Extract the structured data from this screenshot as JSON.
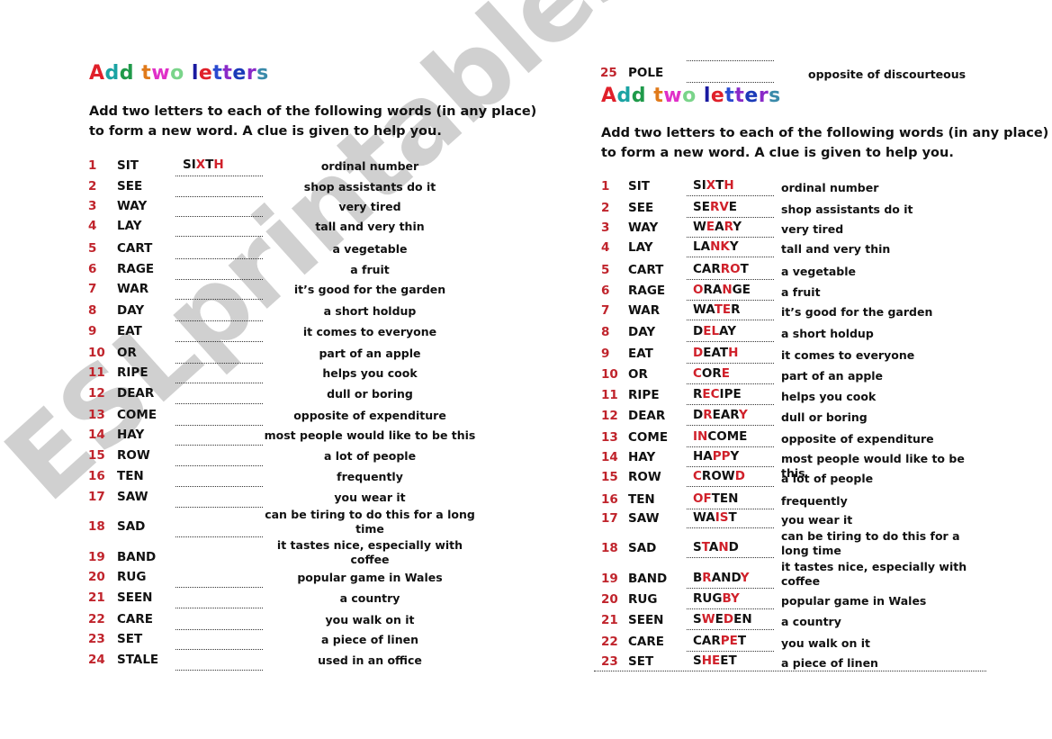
{
  "worksheet": {
    "title_letters": [
      {
        "ch": "A",
        "color": "#e0202a"
      },
      {
        "ch": "d",
        "color": "#1aa3a3"
      },
      {
        "ch": "d",
        "color": "#1f9a4a"
      },
      {
        "ch": " ",
        "color": "#000000"
      },
      {
        "ch": "t",
        "color": "#e07a1a"
      },
      {
        "ch": "w",
        "color": "#e030c8"
      },
      {
        "ch": "o",
        "color": "#7ad48a"
      },
      {
        "ch": " ",
        "color": "#000000"
      },
      {
        "ch": "l",
        "color": "#1a1aa0"
      },
      {
        "ch": "e",
        "color": "#e0202a"
      },
      {
        "ch": "t",
        "color": "#2a4ad0"
      },
      {
        "ch": "t",
        "color": "#8a2ac8"
      },
      {
        "ch": "e",
        "color": "#1a3ab8"
      },
      {
        "ch": "r",
        "color": "#8a2ac8"
      },
      {
        "ch": "s",
        "color": "#3a8aaa"
      }
    ],
    "instructions_line1": "Add two letters to each of the following words (in any place)",
    "instructions_line2": "to form a new word. A clue is given to help you.",
    "questions": [
      {
        "n": "1",
        "word": "SIT",
        "clue": "ordinal number"
      },
      {
        "n": "2",
        "word": "SEE",
        "clue": "shop assistants do it"
      },
      {
        "n": "3",
        "word": "WAY",
        "clue": "very tired"
      },
      {
        "n": "4",
        "word": "LAY",
        "clue": "tall and very thin"
      },
      {
        "n": "5",
        "word": "CART",
        "clue": "a vegetable"
      },
      {
        "n": "6",
        "word": "RAGE",
        "clue": "a fruit"
      },
      {
        "n": "7",
        "word": "WAR",
        "clue": "it’s good for the garden"
      },
      {
        "n": "8",
        "word": "DAY",
        "clue": "a short holdup"
      },
      {
        "n": "9",
        "word": "EAT",
        "clue": "it comes to everyone"
      },
      {
        "n": "10",
        "word": "OR",
        "clue": "part of an apple"
      },
      {
        "n": "11",
        "word": "RIPE",
        "clue": "helps you cook"
      },
      {
        "n": "12",
        "word": "DEAR",
        "clue": "dull or boring"
      },
      {
        "n": "13",
        "word": "COME",
        "clue": "opposite of expenditure"
      },
      {
        "n": "14",
        "word": "HAY",
        "clue": "most people would like to be this"
      },
      {
        "n": "15",
        "word": "ROW",
        "clue": "a lot of people"
      },
      {
        "n": "16",
        "word": "TEN",
        "clue": "frequently"
      },
      {
        "n": "17",
        "word": "SAW",
        "clue": "you wear it"
      },
      {
        "n": "18",
        "word": "SAD",
        "clue": "can be tiring to do this for a long time"
      },
      {
        "n": "19",
        "word": "BAND",
        "clue": "it tastes nice, especially with coffee"
      },
      {
        "n": "20",
        "word": "RUG",
        "clue": "popular game in Wales"
      },
      {
        "n": "21",
        "word": "SEEN",
        "clue": "a country"
      },
      {
        "n": "22",
        "word": "CARE",
        "clue": "you walk on it"
      },
      {
        "n": "23",
        "word": "SET",
        "clue": "a piece of linen"
      },
      {
        "n": "24",
        "word": "STALE",
        "clue": "used in an office"
      },
      {
        "n": "25",
        "word": "POLE",
        "clue": "opposite of discourteous"
      }
    ],
    "left_example_answer": [
      {
        "t": "SI",
        "add": false
      },
      {
        "t": "X",
        "add": true
      },
      {
        "t": "T",
        "add": false
      },
      {
        "t": "H",
        "add": true
      }
    ],
    "answers": [
      [
        {
          "t": "SI",
          "add": false
        },
        {
          "t": "X",
          "add": true
        },
        {
          "t": "T",
          "add": false
        },
        {
          "t": "H",
          "add": true
        }
      ],
      [
        {
          "t": "SE",
          "add": false
        },
        {
          "t": "RV",
          "add": true
        },
        {
          "t": "E",
          "add": false
        }
      ],
      [
        {
          "t": "W",
          "add": false
        },
        {
          "t": "E",
          "add": true
        },
        {
          "t": "A",
          "add": false
        },
        {
          "t": "R",
          "add": true
        },
        {
          "t": "Y",
          "add": false
        }
      ],
      [
        {
          "t": "LA",
          "add": false
        },
        {
          "t": "NK",
          "add": true
        },
        {
          "t": "Y",
          "add": false
        }
      ],
      [
        {
          "t": "CAR",
          "add": false
        },
        {
          "t": "RO",
          "add": true
        },
        {
          "t": "T",
          "add": false
        }
      ],
      [
        {
          "t": "O",
          "add": true
        },
        {
          "t": "RA",
          "add": false
        },
        {
          "t": "N",
          "add": true
        },
        {
          "t": "GE",
          "add": false
        }
      ],
      [
        {
          "t": "WA",
          "add": false
        },
        {
          "t": "TE",
          "add": true
        },
        {
          "t": "R",
          "add": false
        }
      ],
      [
        {
          "t": "D",
          "add": false
        },
        {
          "t": "EL",
          "add": true
        },
        {
          "t": "AY",
          "add": false
        }
      ],
      [
        {
          "t": "D",
          "add": true
        },
        {
          "t": "EAT",
          "add": false
        },
        {
          "t": "H",
          "add": true
        }
      ],
      [
        {
          "t": "C",
          "add": true
        },
        {
          "t": "OR",
          "add": false
        },
        {
          "t": "E",
          "add": true
        }
      ],
      [
        {
          "t": "R",
          "add": false
        },
        {
          "t": "EC",
          "add": true
        },
        {
          "t": "IPE",
          "add": false
        }
      ],
      [
        {
          "t": "D",
          "add": false
        },
        {
          "t": "R",
          "add": true
        },
        {
          "t": "EAR",
          "add": false
        },
        {
          "t": "Y",
          "add": true
        }
      ],
      [
        {
          "t": "IN",
          "add": true
        },
        {
          "t": "COME",
          "add": false
        }
      ],
      [
        {
          "t": "HA",
          "add": false
        },
        {
          "t": "PP",
          "add": true
        },
        {
          "t": "Y",
          "add": false
        }
      ],
      [
        {
          "t": "C",
          "add": true
        },
        {
          "t": "ROW",
          "add": false
        },
        {
          "t": "D",
          "add": true
        }
      ],
      [
        {
          "t": "OF",
          "add": true
        },
        {
          "t": "TEN",
          "add": false
        }
      ],
      [
        {
          "t": "WA",
          "add": false
        },
        {
          "t": "IS",
          "add": true
        },
        {
          "t": "T",
          "add": false
        }
      ],
      [
        {
          "t": "S",
          "add": false
        },
        {
          "t": "T",
          "add": true
        },
        {
          "t": "A",
          "add": false
        },
        {
          "t": "N",
          "add": true
        },
        {
          "t": "D",
          "add": false
        }
      ],
      [
        {
          "t": "B",
          "add": false
        },
        {
          "t": "R",
          "add": true
        },
        {
          "t": "AND",
          "add": false
        },
        {
          "t": "Y",
          "add": true
        }
      ],
      [
        {
          "t": "RUG",
          "add": false
        },
        {
          "t": "BY",
          "add": true
        }
      ],
      [
        {
          "t": "S",
          "add": false
        },
        {
          "t": "W",
          "add": true
        },
        {
          "t": "E",
          "add": false
        },
        {
          "t": "D",
          "add": true
        },
        {
          "t": "EN",
          "add": false
        }
      ],
      [
        {
          "t": "CAR",
          "add": false
        },
        {
          "t": "PE",
          "add": true
        },
        {
          "t": "T",
          "add": false
        }
      ],
      [
        {
          "t": "S",
          "add": false
        },
        {
          "t": "HE",
          "add": true
        },
        {
          "t": "ET",
          "add": false
        }
      ]
    ],
    "watermark": "ESLprintables.com",
    "colors": {
      "number": "#c0242c",
      "added_letter": "#d0202a",
      "watermark": "#c8c8c8"
    }
  }
}
